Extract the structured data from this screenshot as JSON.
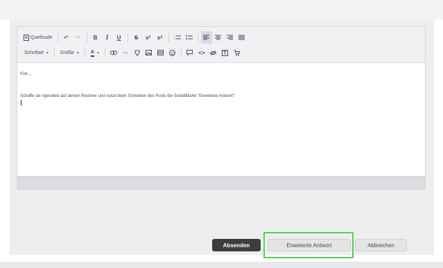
{
  "toolbar": {
    "source_label": "Quellcode",
    "font_label": "Schriftart",
    "size_label": "Größe",
    "color_letter": "A"
  },
  "editor": {
    "paragraph1": "Klar....",
    "paragraph2": "Schaffe sie irgendwie auf deinen Rechner und nutze beim Schreiben des Posts die Schaltfläche \"Erweiterte Antwort\":"
  },
  "actions": {
    "submit_label": "Absenden",
    "advanced_label": "Erweiterte Antwort",
    "cancel_label": "Abbrechen"
  },
  "colors": {
    "highlight": "#55d14c",
    "submit_bg": "#3d3d3f",
    "toolbar_icon": "#3b4a63"
  }
}
